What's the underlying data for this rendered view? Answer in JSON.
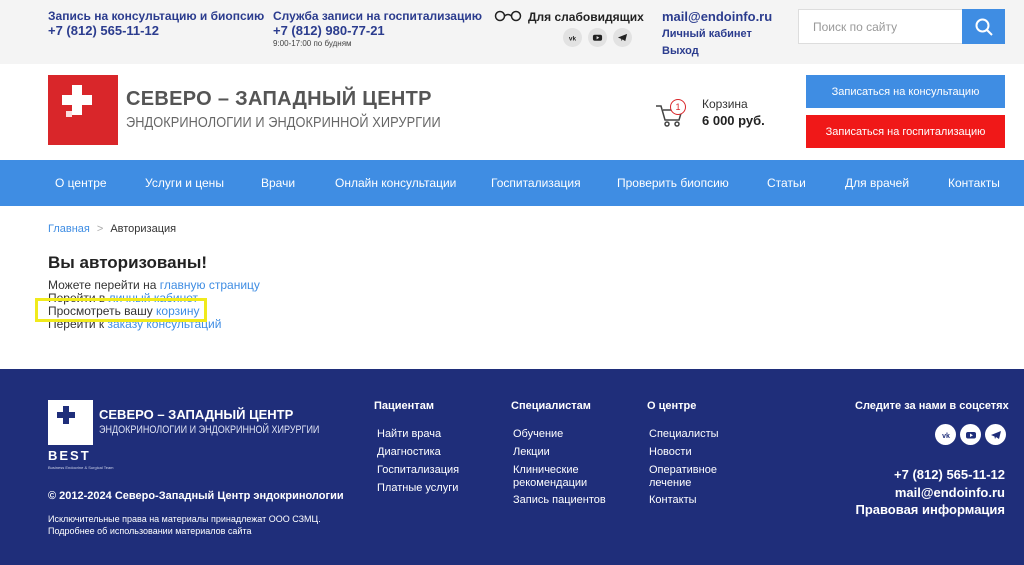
{
  "topbar": {
    "consult_title": "Запись на консультацию и биопсию",
    "consult_phone": "+7 (812) 565-11-12",
    "hosp_title": "Служба записи на госпитализацию",
    "hosp_phone": "+7 (812) 980-77-21",
    "hosp_hours": "9:00-17:00 по будням",
    "blind_label": "Для слабовидящих",
    "email": "mail@endoinfo.ru",
    "cabinet": "Личный кабинет",
    "logout": "Выход",
    "search_placeholder": "Поиск по сайту",
    "social_icons": [
      "vk-icon",
      "youtube-icon",
      "telegram-icon"
    ]
  },
  "header": {
    "logo_title": "СЕВЕРО – ЗАПАДНЫЙ ЦЕНТР",
    "logo_subtitle": "ЭНДОКРИНОЛОГИИ И ЭНДОКРИННОЙ ХИРУРГИИ",
    "cart_count": "1",
    "cart_label": "Корзина",
    "cart_sum": "6 000 руб.",
    "btn_consult": "Записаться на консультацию",
    "btn_hosp": "Записаться на госпитализацию"
  },
  "nav": {
    "items": [
      "О центре",
      "Услуги и цены",
      "Врачи",
      "Онлайн консультации",
      "Госпитализация",
      "Проверить биопсию",
      "Статьи",
      "Для врачей",
      "Контакты"
    ]
  },
  "breadcrumb": {
    "home": "Главная",
    "sep": ">",
    "current": "Авторизация"
  },
  "content": {
    "title": "Вы авторизованы!",
    "line1_text": "Можете перейти на ",
    "line1_link": "главную страницу",
    "line2_text": "Перейти в ",
    "line2_link": "личный кабинет",
    "line3_text": "Просмотреть вашу ",
    "line3_link": "корзину",
    "line4_text": "Перейти к ",
    "line4_link": "заказу консультаций"
  },
  "footer": {
    "logo_title": "СЕВЕРО – ЗАПАДНЫЙ ЦЕНТР",
    "logo_subtitle": "ЭНДОКРИНОЛОГИИ И ЭНДОКРИННОЙ ХИРУРГИИ",
    "best": "BEST",
    "best_sub": "Business Endocrine & Surgical Team",
    "copyright": "© 2012-2024 Северо-Западный Центр эндокринологии",
    "rights_1": "Исключительные права на материалы принадлежат ООО СЗМЦ.",
    "rights_2": "Подробнее об использовании материалов сайта",
    "col_patients": {
      "title": "Пациентам",
      "links": [
        "Найти врача",
        "Диагностика",
        "Госпитализация",
        "Платные услуги"
      ]
    },
    "col_specialists": {
      "title": "Специалистам",
      "links": [
        "Обучение",
        "Лекции",
        "Клинические",
        "рекомендации",
        "Запись пациентов"
      ]
    },
    "col_about": {
      "title": "О центре",
      "links": [
        "Специалисты",
        "Новости",
        "Оперативное",
        "лечение",
        "Контакты"
      ]
    },
    "follow": "Следите за нами в соцсетях",
    "phone": "+7 (812) 565-11-12",
    "email": "mail@endoinfo.ru",
    "legal": "Правовая информация"
  },
  "colors": {
    "accent": "#3f8de3",
    "danger": "#f01818",
    "brand_red": "#d9262a",
    "footer_bg": "#1f2e7a",
    "highlight": "#f0ea1c"
  }
}
